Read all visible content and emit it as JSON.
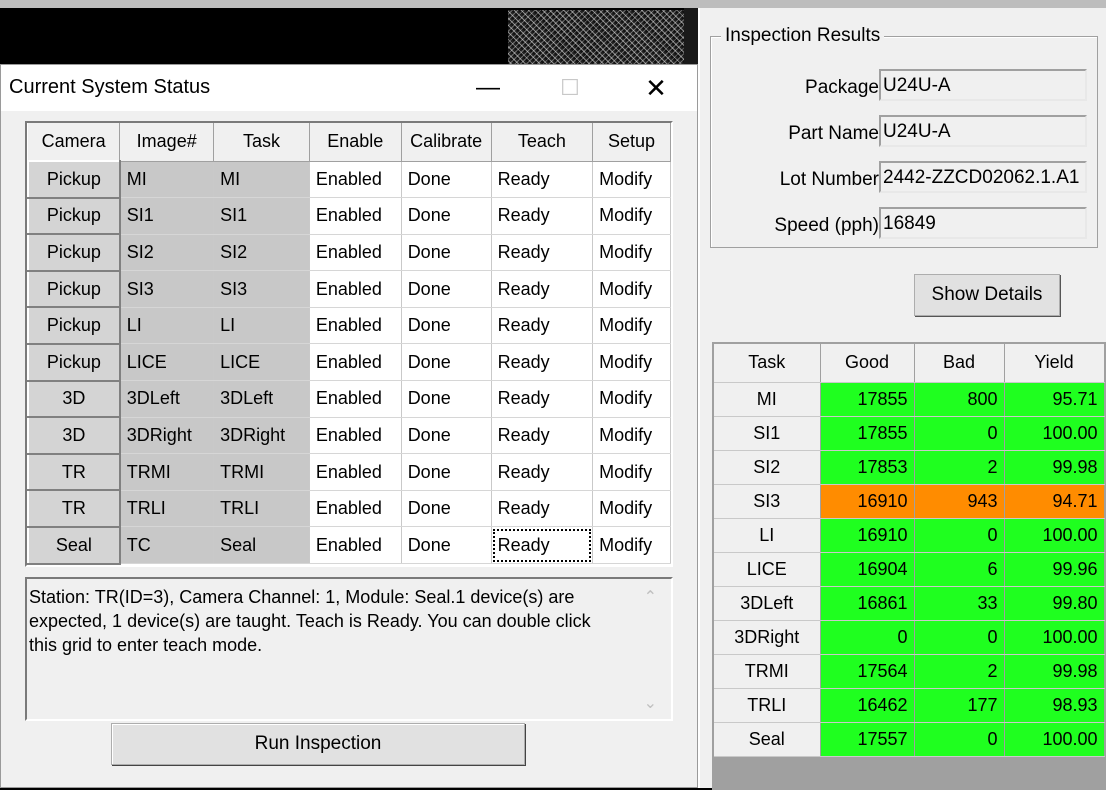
{
  "dialog": {
    "title": "Current System Status",
    "window_buttons": {
      "minimize": "—",
      "maximize": "☐",
      "close": "✕"
    },
    "grid": {
      "headers": [
        "Camera",
        "Image#",
        "Task",
        "Enable",
        "Calibrate",
        "Teach",
        "Setup"
      ],
      "rows": [
        {
          "camera": "Pickup",
          "image": "MI",
          "task": "MI",
          "enable": "Enabled",
          "calibrate": "Done",
          "teach": "Ready",
          "setup": "Modify"
        },
        {
          "camera": "Pickup",
          "image": "SI1",
          "task": "SI1",
          "enable": "Enabled",
          "calibrate": "Done",
          "teach": "Ready",
          "setup": "Modify"
        },
        {
          "camera": "Pickup",
          "image": "SI2",
          "task": "SI2",
          "enable": "Enabled",
          "calibrate": "Done",
          "teach": "Ready",
          "setup": "Modify"
        },
        {
          "camera": "Pickup",
          "image": "SI3",
          "task": "SI3",
          "enable": "Enabled",
          "calibrate": "Done",
          "teach": "Ready",
          "setup": "Modify"
        },
        {
          "camera": "Pickup",
          "image": "LI",
          "task": "LI",
          "enable": "Enabled",
          "calibrate": "Done",
          "teach": "Ready",
          "setup": "Modify"
        },
        {
          "camera": "Pickup",
          "image": "LICE",
          "task": "LICE",
          "enable": "Enabled",
          "calibrate": "Done",
          "teach": "Ready",
          "setup": "Modify"
        },
        {
          "camera": "3D",
          "image": "3DLeft",
          "task": "3DLeft",
          "enable": "Enabled",
          "calibrate": "Done",
          "teach": "Ready",
          "setup": "Modify"
        },
        {
          "camera": "3D",
          "image": "3DRight",
          "task": "3DRight",
          "enable": "Enabled",
          "calibrate": "Done",
          "teach": "Ready",
          "setup": "Modify"
        },
        {
          "camera": "TR",
          "image": "TRMI",
          "task": "TRMI",
          "enable": "Enabled",
          "calibrate": "Done",
          "teach": "Ready",
          "setup": "Modify"
        },
        {
          "camera": "TR",
          "image": "TRLI",
          "task": "TRLI",
          "enable": "Enabled",
          "calibrate": "Done",
          "teach": "Ready",
          "setup": "Modify"
        },
        {
          "camera": "Seal",
          "image": "TC",
          "task": "Seal",
          "enable": "Enabled",
          "calibrate": "Done",
          "teach": "Ready",
          "setup": "Modify"
        }
      ],
      "focused_row": 10,
      "focused_column": "teach"
    },
    "description": "Station: TR(ID=3), Camera Channel: 1, Module: Seal.1 device(s) are expected, 1 device(s) are taught. Teach is Ready. You can double click this grid to enter teach mode.",
    "scroll_up": "⌃",
    "scroll_down": "⌄",
    "run_button": "Run Inspection"
  },
  "inspection_results": {
    "title": "Inspection Results",
    "fields": [
      {
        "label": "Package",
        "value": "U24U-A"
      },
      {
        "label": "Part Name",
        "value": "U24U-A"
      },
      {
        "label": "Lot Number",
        "value": "2442-ZZCD02062.1.A1"
      },
      {
        "label": "Speed (pph)",
        "value": "16849"
      }
    ],
    "show_details": "Show Details",
    "results": {
      "headers": [
        "Task",
        "Good",
        "Bad",
        "Yield"
      ],
      "rows": [
        {
          "task": "MI",
          "good": "17855",
          "bad": "800",
          "yield": "95.71",
          "status": "good"
        },
        {
          "task": "SI1",
          "good": "17855",
          "bad": "0",
          "yield": "100.00",
          "status": "good"
        },
        {
          "task": "SI2",
          "good": "17853",
          "bad": "2",
          "yield": "99.98",
          "status": "good"
        },
        {
          "task": "SI3",
          "good": "16910",
          "bad": "943",
          "yield": "94.71",
          "status": "warn"
        },
        {
          "task": "LI",
          "good": "16910",
          "bad": "0",
          "yield": "100.00",
          "status": "good"
        },
        {
          "task": "LICE",
          "good": "16904",
          "bad": "6",
          "yield": "99.96",
          "status": "good"
        },
        {
          "task": "3DLeft",
          "good": "16861",
          "bad": "33",
          "yield": "99.80",
          "status": "good"
        },
        {
          "task": "3DRight",
          "good": "0",
          "bad": "0",
          "yield": "100.00",
          "status": "good"
        },
        {
          "task": "TRMI",
          "good": "17564",
          "bad": "2",
          "yield": "99.98",
          "status": "good"
        },
        {
          "task": "TRLI",
          "good": "16462",
          "bad": "177",
          "yield": "98.93",
          "status": "good"
        },
        {
          "task": "Seal",
          "good": "17557",
          "bad": "0",
          "yield": "100.00",
          "status": "good"
        }
      ]
    }
  },
  "colors": {
    "good": "#1fff1f",
    "warn": "#ff8c00"
  }
}
